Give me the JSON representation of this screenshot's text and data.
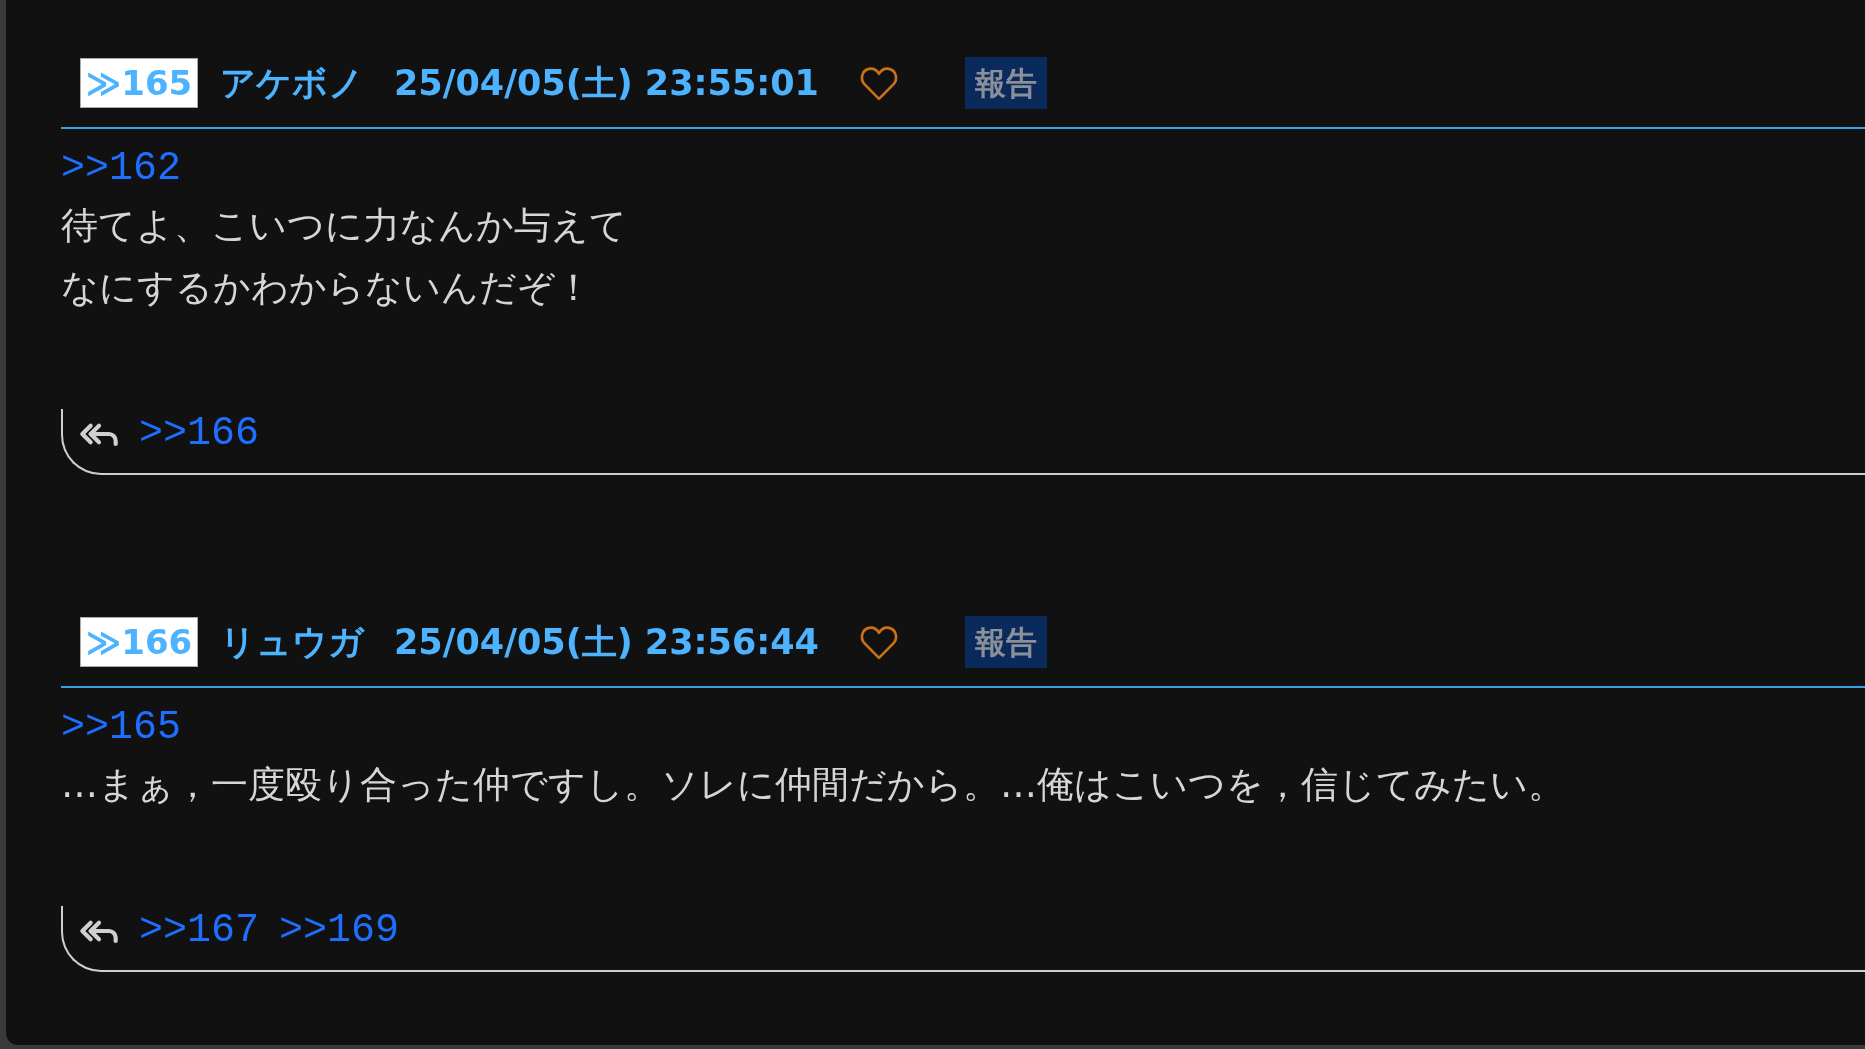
{
  "posts": [
    {
      "number": "≫165",
      "name": "アケボノ",
      "date": "25/04/05(土) 23:55:01",
      "liked": false,
      "report": "報告",
      "quote": ">>162",
      "body": [
        "待てよ、こいつに力なんか与えて",
        "なにするかわからないんだぞ！"
      ],
      "replies": [
        ">>166"
      ]
    },
    {
      "number": "≫166",
      "name": "リュウガ",
      "date": "25/04/05(土) 23:56:44",
      "liked": false,
      "report": "報告",
      "quote": ">>165",
      "body": [
        "…まぁ，一度殴り合った仲ですし。ソレに仲間だから。…俺はこいつを，信じてみたい。"
      ],
      "replies": [
        ">>167",
        ">>169"
      ]
    }
  ]
}
